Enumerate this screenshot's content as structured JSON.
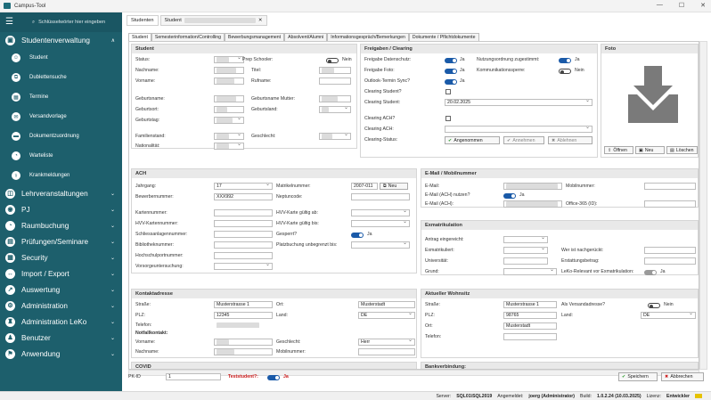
{
  "window": {
    "title": "Campus-Tool",
    "minimize": "—",
    "maximize": "☐",
    "close": "✕"
  },
  "sidebar": {
    "search_placeholder": "Schlüsselwörter hier eingeben",
    "sections": [
      {
        "label": "Studentenverwaltung",
        "chev": "∧"
      },
      {
        "label": "Lehrveranstaltungen",
        "chev": "⌄"
      },
      {
        "label": "PJ",
        "chev": "⌄"
      },
      {
        "label": "Raumbuchung",
        "chev": "⌄"
      },
      {
        "label": "Prüfungen/Seminare",
        "chev": "⌄"
      },
      {
        "label": "Security",
        "chev": "⌄"
      },
      {
        "label": "Import / Export",
        "chev": "⌄"
      },
      {
        "label": "Auswertung",
        "chev": "⌄"
      },
      {
        "label": "Administration",
        "chev": "⌄"
      },
      {
        "label": "Administration LeKo",
        "chev": "⌄"
      },
      {
        "label": "Benutzer",
        "chev": "⌄"
      },
      {
        "label": "Anwendung",
        "chev": "⌄"
      }
    ],
    "subitems": [
      "Student",
      "Dublettensuche",
      "Termine",
      "Versandvorlage",
      "Dokumentzuordnung",
      "Warteliste",
      "Krankmeldungen"
    ]
  },
  "doc_tabs": {
    "tab1": "Studenten",
    "tab2": "Student",
    "close": "✕"
  },
  "record_tabs": [
    "Student",
    "Semesterinformation/Controlling",
    "Bewerbungsmanagement",
    "Absolvent/Alumni",
    "Informationsgespräch/Bemerkungen",
    "Dokumente / Pflichtdokumente"
  ],
  "student": {
    "header": "Student",
    "status_label": "Status:",
    "prepschool_label": "Prep Schooler:",
    "prepschool_value": "Nein",
    "nachname_label": "Nachname:",
    "titel_label": "Titel:",
    "vorname_label": "Vorname:",
    "rufname_label": "Rufname:",
    "geburtsname_label": "Geburtsname:",
    "geburtsname_mutter_label": "Geburtsname Mutter:",
    "geburtsort_label": "Geburtsort:",
    "geburtsland_label": "Geburtsland:",
    "geburtstag_label": "Geburtstag:",
    "familienstand_label": "Familienstand:",
    "geschlecht_label": "Geschlecht:",
    "nationalitaet_label": "Nationalität:"
  },
  "freigaben": {
    "header": "Freigaben / Clearing",
    "datenschutz_label": "Freigabe Datenschutz:",
    "datenschutz_value": "Ja",
    "foto_label": "Freigabe Foto:",
    "foto_value": "Ja",
    "outlook_label": "Outlook-Termin Sync?",
    "outlook_value": "Ja",
    "nutzungsordnung_label": "Nutzungsordnung zugestimmt:",
    "nutzungsordnung_value": "Ja",
    "kommunikation_label": "Kommunikationssperre:",
    "kommunikation_value": "Nein",
    "clearing_student_q": "Clearing Student?",
    "clearing_student_label": "Clearing Student:",
    "clearing_student_value": "20.02.2025",
    "clearing_ach_q": "Clearing ACH?",
    "clearing_ach_label": "Clearing ACH:",
    "clearing_status_label": "Clearing-Status:",
    "angenommen": "Angenommen",
    "annehmen": "Annehmen",
    "ablehnen": "Ablehnen"
  },
  "foto": {
    "header": "Foto",
    "open": "Öffnen",
    "new": "Neu",
    "delete": "Löschen"
  },
  "ach": {
    "header": "ACH",
    "jahrgang_label": "Jahrgang:",
    "jahrgang_value": "17",
    "matrikel_label": "Matrikelnummer:",
    "matrikel_value": "2007-011",
    "neu": "Neu",
    "bewerber_label": "Bewerbernummer:",
    "bewerber_value": "XXX992",
    "neptun_label": "Neptuncode:",
    "karten_label": "Kartennummer:",
    "hvv_ab_label": "HVV-Karte gültig ab:",
    "hvv_nr_label": "HVV-Kartennummer:",
    "hvv_bis_label": "HVV-Karte gültig bis:",
    "schliess_label": "Schliessanlagennummer:",
    "gesperrt_label": "Gesperrt?",
    "gesperrt_value": "Ja",
    "bib_label": "Bibliotheknummer:",
    "platz_label": "Platzbuchung unbegrenzt bis:",
    "hochschul_label": "Hochschulportnummer:",
    "vorsorge_label": "Vorsorgeuntersuchung:"
  },
  "email": {
    "header": "E-Mail / Mobilnummer",
    "email_label": "E-Mail:",
    "mobil_label": "Mobilnummer:",
    "ach_nutzen_label": "E-Mail (ACH) nutzen?",
    "ach_nutzen_value": "Ja",
    "email_ach_label": "E-Mail (ACH):",
    "office_label": "Office-365 (ID):"
  },
  "exmatrikulation": {
    "header": "Exmatrikulation",
    "antrag_label": "Antrag eingereicht:",
    "exmatrikuliert_label": "Exmatrikuliert:",
    "wer_label": "Wer ist nachgerückt:",
    "universitaet_label": "Universität:",
    "erstattung_label": "Erstattungsbetrag:",
    "grund_label": "Grund:",
    "leko_label": "LeKo-Relevant vor Exmatrikulation:",
    "leko_value": "Ja"
  },
  "kontakt": {
    "header": "Kontaktadresse",
    "strasse_label": "Straße:",
    "strasse_value": "Musterstrasse 1",
    "ort_label": "Ort:",
    "ort_value": "Musterstadt",
    "plz_label": "PLZ:",
    "plz_value": "12345",
    "land_label": "Land:",
    "land_value": "DE",
    "telefon_label": "Telefon:",
    "notfall_label": "Notfallkontakt:",
    "vorname_label": "Vorname:",
    "geschlecht_label": "Geschlecht:",
    "geschlecht_value": "Herr",
    "nachname_label": "Nachname:",
    "mobil_label": "Mobilnummer:"
  },
  "wohnsitz": {
    "header": "Aktueller Wohnsitz",
    "strasse_label": "Straße:",
    "strasse_value": "Musterstrasse 1",
    "versand_label": "Als Versandadresse?",
    "versand_value": "Nein",
    "plz_label": "PLZ:",
    "plz_value": "98765",
    "land_label": "Land:",
    "land_value": "DE",
    "ort_label": "Ort:",
    "ort_value": "Musterstadt",
    "telefon_label": "Telefon:"
  },
  "covid": {
    "header": "COVID"
  },
  "bank": {
    "header": "Bankverbindung:"
  },
  "bottom": {
    "pk_label": "PK-ID",
    "pk_value": "1",
    "test_label": "Teststudent?:",
    "test_value": "Ja",
    "save": "Speichern",
    "cancel": "Abbrechen"
  },
  "status": {
    "server_label": "Server:",
    "server_value": "SQL01\\SQL2019",
    "user_label": "Angemeldet:",
    "user_value": "joerg (Administrator)",
    "build_label": "Build:",
    "build_value": "1.0.2.24 (10.03.2025)",
    "lizenz_label": "Lizenz:",
    "lizenz_value": "Entwickler"
  },
  "colors": {
    "sidebar": "#1d5f6c",
    "toggle_on": "#1a5aa8",
    "test_red": "#cc1b1b"
  }
}
